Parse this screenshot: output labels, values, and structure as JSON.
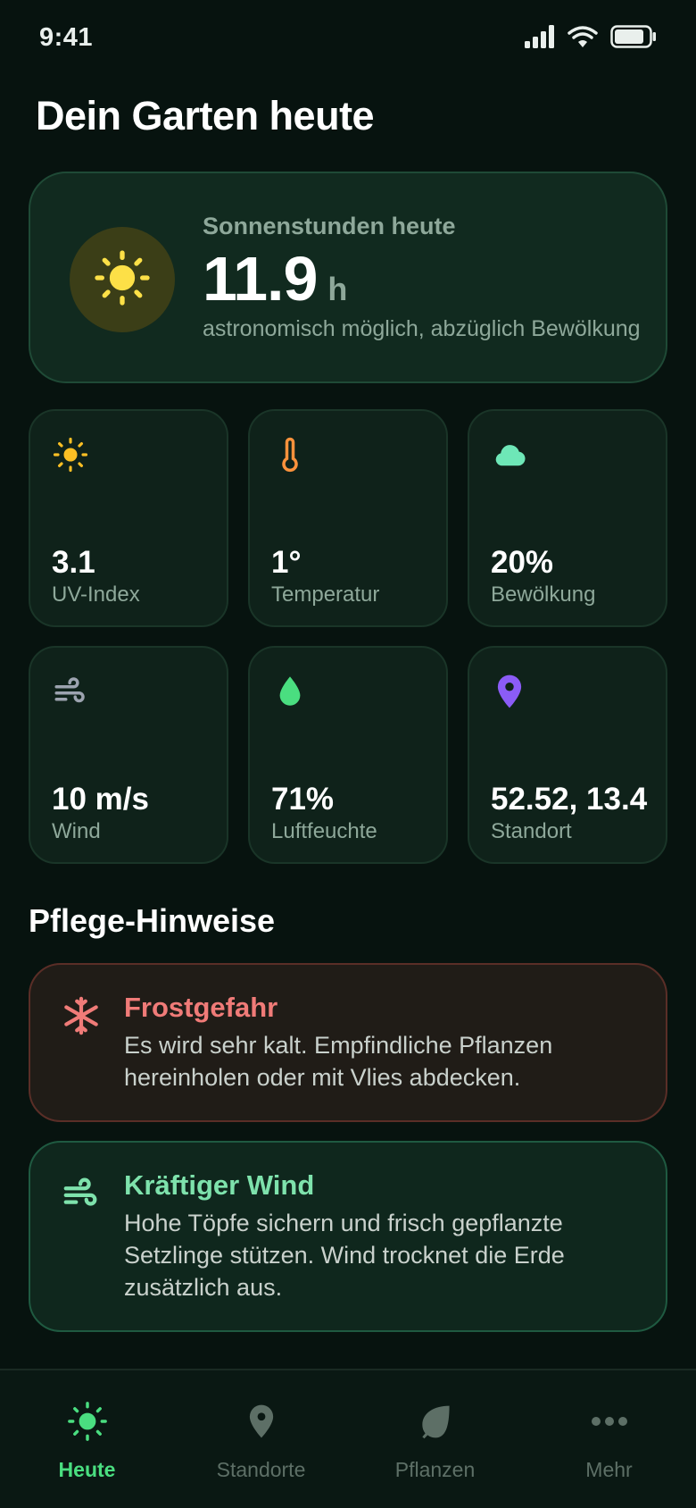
{
  "status_bar": {
    "time": "9:41"
  },
  "page": {
    "title": "Dein Garten heute"
  },
  "hero": {
    "label": "Sonnenstunden heute",
    "value": "11.9",
    "unit": "h",
    "subtitle": "astronomisch möglich, abzüglich Bewölkung",
    "icon": "sun-icon"
  },
  "stats": [
    {
      "value": "3.1",
      "label": "UV-Index",
      "icon": "sun-icon",
      "color": "#fbbf24"
    },
    {
      "value": "1°",
      "label": "Temperatur",
      "icon": "thermometer-icon",
      "color": "#fb923c"
    },
    {
      "value": "20%",
      "label": "Bewölkung",
      "icon": "cloud-icon",
      "color": "#6ee7b7"
    },
    {
      "value": "10 m/s",
      "label": "Wind",
      "icon": "wind-icon",
      "color": "#9ca3af"
    },
    {
      "value": "71%",
      "label": "Luftfeuchte",
      "icon": "droplet-icon",
      "color": "#4ade80"
    },
    {
      "value": "52.52, 13.4",
      "label": "Standort",
      "icon": "map-pin-icon",
      "color": "#8b5cf6"
    }
  ],
  "care": {
    "title": "Pflege-Hinweise",
    "hints": [
      {
        "title": "Frostgefahr",
        "text": "Es wird sehr kalt. Empfindliche Pflanzen hereinholen oder mit Vlies abdecken.",
        "icon": "snowflake-icon",
        "color": "#f07b78"
      },
      {
        "title": "Kräftiger Wind",
        "text": "Hohe Töpfe sichern und frisch gepflanzte Setzlinge stützen. Wind trocknet die Erde zusätzlich aus.",
        "icon": "wind-icon",
        "color": "#7ee2ac"
      }
    ]
  },
  "nav": {
    "items": [
      {
        "label": "Heute",
        "icon": "sun-icon",
        "active": true
      },
      {
        "label": "Standorte",
        "icon": "map-pin-icon",
        "active": false
      },
      {
        "label": "Pflanzen",
        "icon": "leaf-icon",
        "active": false
      },
      {
        "label": "Mehr",
        "icon": "more-icon",
        "active": false
      }
    ]
  },
  "colors": {
    "background": "#07130f",
    "accent": "#4ade80",
    "sun": "#fde047"
  }
}
